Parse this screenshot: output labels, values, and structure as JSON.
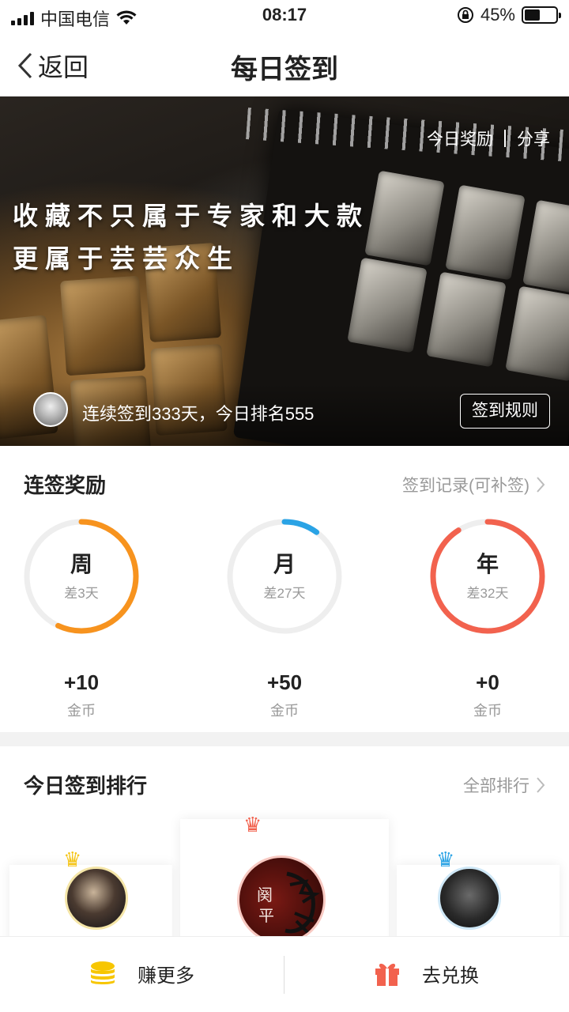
{
  "status_bar": {
    "carrier": "中国电信",
    "time": "08:17",
    "battery": "45%",
    "battery_level": 0.45
  },
  "nav": {
    "back_label": "返回",
    "title": "每日签到"
  },
  "banner": {
    "links": {
      "today_reward": "今日奖励",
      "share": "分享"
    },
    "slogan_line1": "收藏不只属于专家和大款",
    "slogan_line2": "更属于芸芸众生",
    "streak_text": "连续签到333天，今日排名555",
    "rules_button": "签到规则"
  },
  "rewards": {
    "title": "连签奖励",
    "record_link": "签到记录(可补签)",
    "items": [
      {
        "label": "周",
        "remaining": "差3天",
        "coins": "+10",
        "unit": "金币",
        "progress": 0.57,
        "color": "#f7931e"
      },
      {
        "label": "月",
        "remaining": "差27天",
        "coins": "+50",
        "unit": "金币",
        "progress": 0.1,
        "color": "#2aa3e5"
      },
      {
        "label": "年",
        "remaining": "差32天",
        "coins": "+0",
        "unit": "金币",
        "progress": 0.91,
        "color": "#f2624e"
      }
    ]
  },
  "ranking": {
    "title": "今日签到排行",
    "all_link": "全部排行",
    "crown_colors": {
      "first": "#f2624e",
      "second": "#f5c518",
      "third": "#2aa3e5"
    }
  },
  "bottom_bar": {
    "earn_more": "赚更多",
    "exchange": "去兑换"
  }
}
